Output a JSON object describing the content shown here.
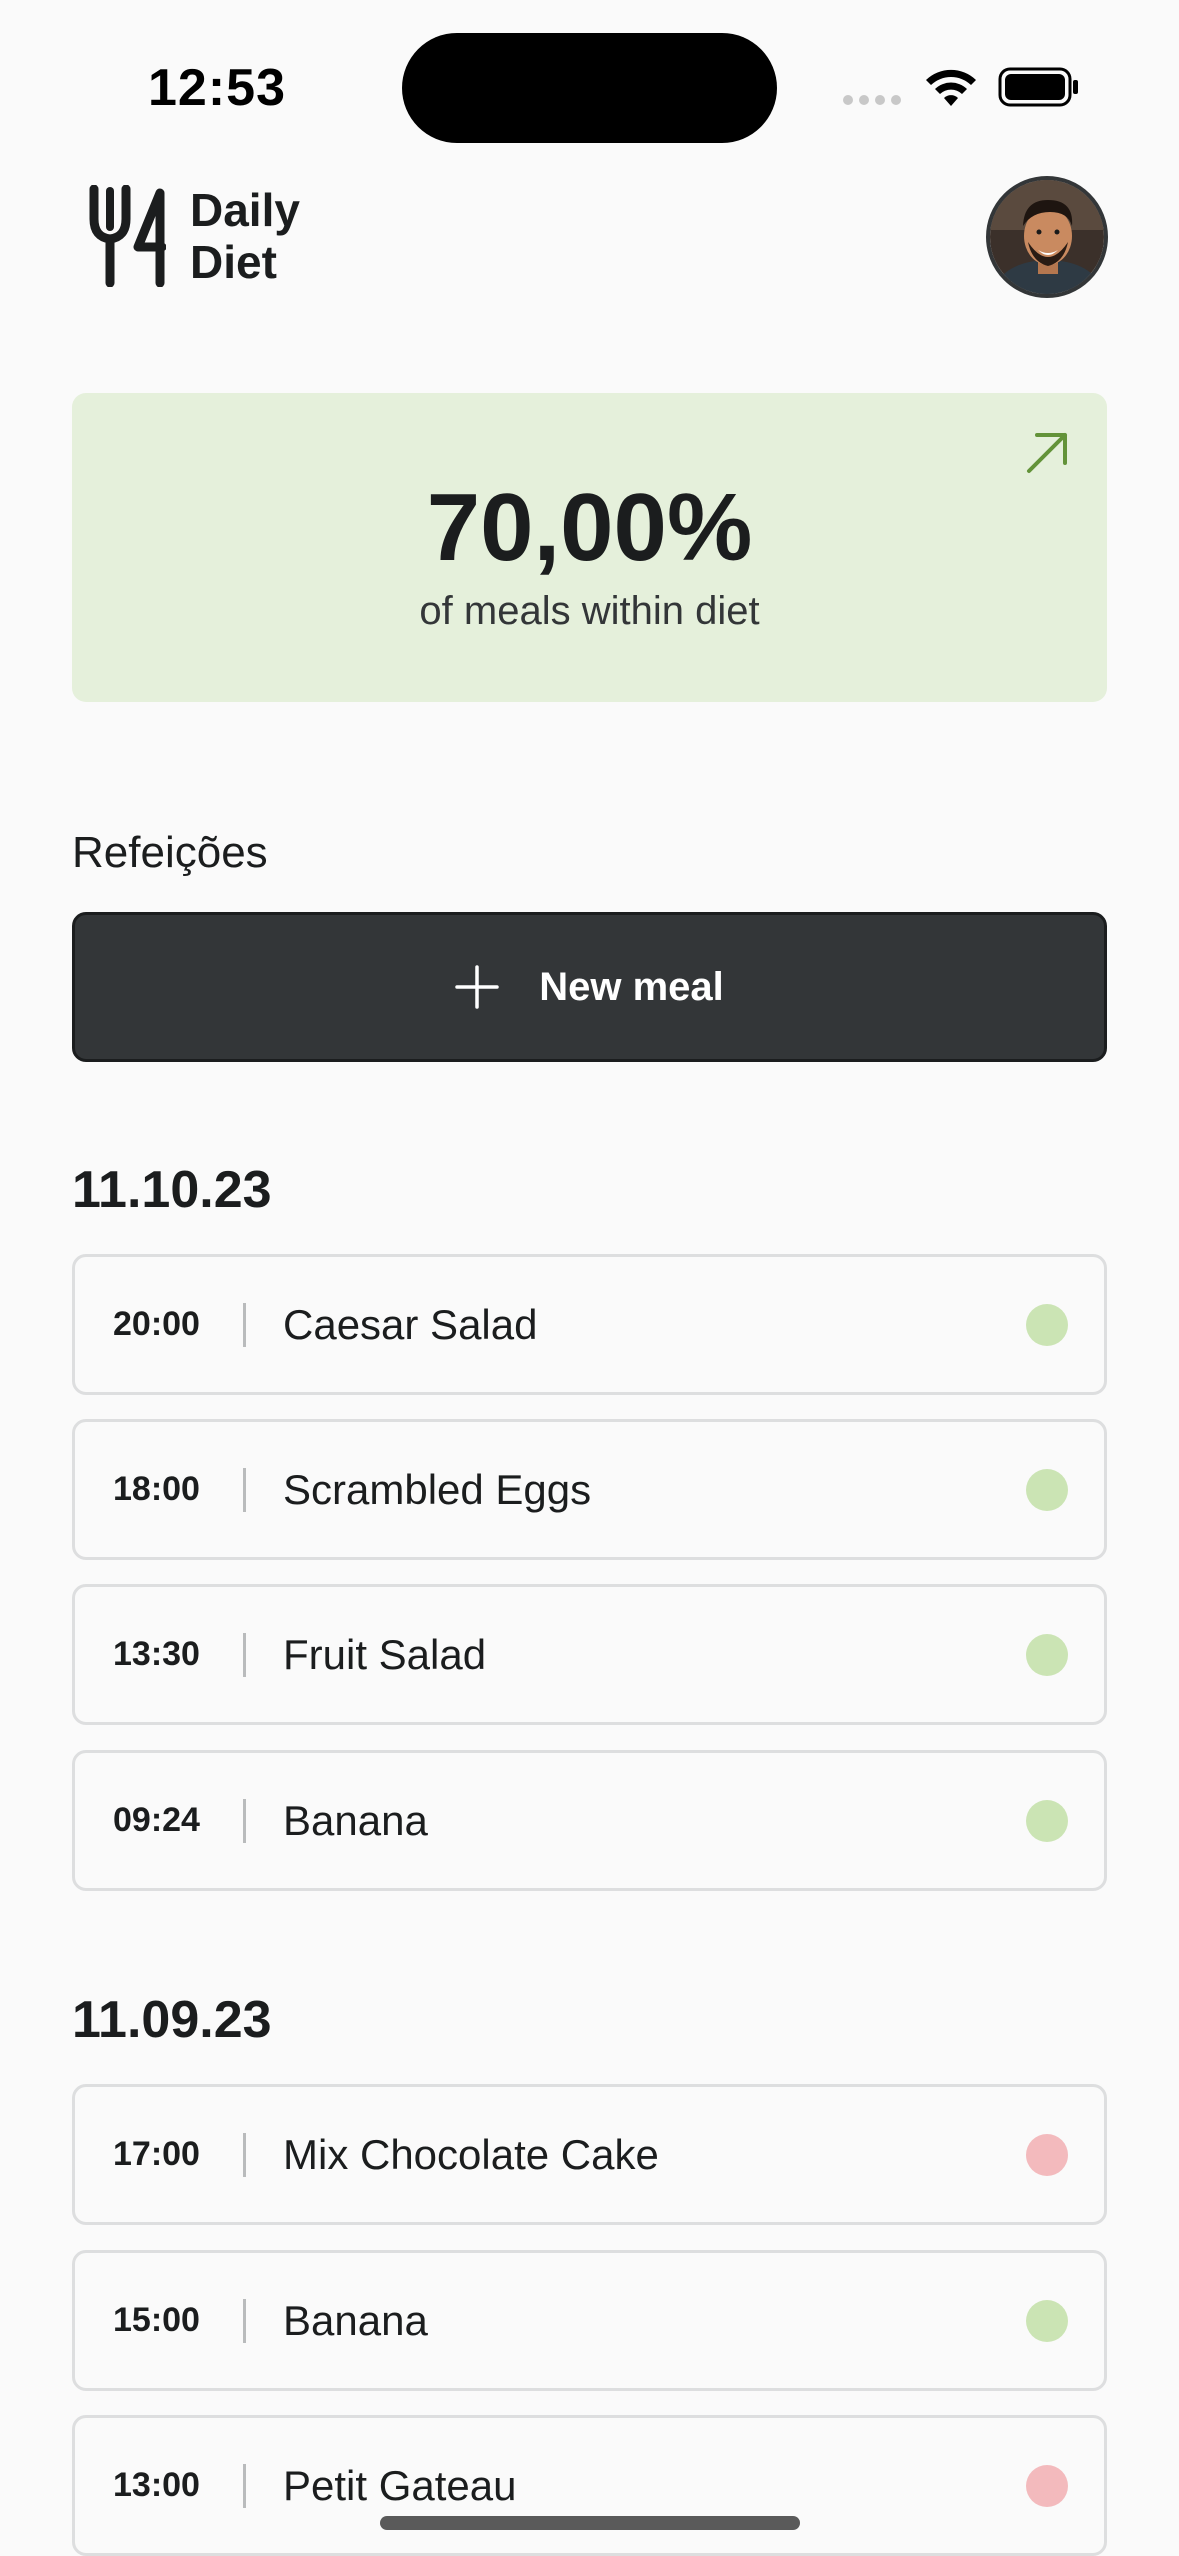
{
  "status_bar": {
    "time": "12:53"
  },
  "header": {
    "logo_line1": "Daily",
    "logo_line2": "Diet",
    "logo_icon": "fork-knife-icon",
    "avatar_icon": "user-avatar"
  },
  "stats": {
    "value": "70,00%",
    "caption": "of meals within diet",
    "arrow_icon": "arrow-up-right-icon"
  },
  "meals_section": {
    "title": "Refeições",
    "new_meal_label": "New meal",
    "new_meal_icon": "plus-icon"
  },
  "colors": {
    "in_diet": "#CBE4B4",
    "off_diet": "#F3BABD",
    "card_green": "#E5F0DB",
    "dark_button": "#333638"
  },
  "groups": [
    {
      "date": "11.10.23",
      "meals": [
        {
          "time": "20:00",
          "name": "Caesar Salad",
          "status": "in_diet"
        },
        {
          "time": "18:00",
          "name": "Scrambled Eggs",
          "status": "in_diet"
        },
        {
          "time": "13:30",
          "name": "Fruit Salad",
          "status": "in_diet"
        },
        {
          "time": "09:24",
          "name": "Banana",
          "status": "in_diet"
        }
      ]
    },
    {
      "date": "11.09.23",
      "meals": [
        {
          "time": "17:00",
          "name": "Mix Chocolate Cake",
          "status": "off_diet"
        },
        {
          "time": "15:00",
          "name": "Banana",
          "status": "in_diet"
        },
        {
          "time": "13:00",
          "name": "Petit Gateau",
          "status": "off_diet"
        }
      ]
    }
  ]
}
